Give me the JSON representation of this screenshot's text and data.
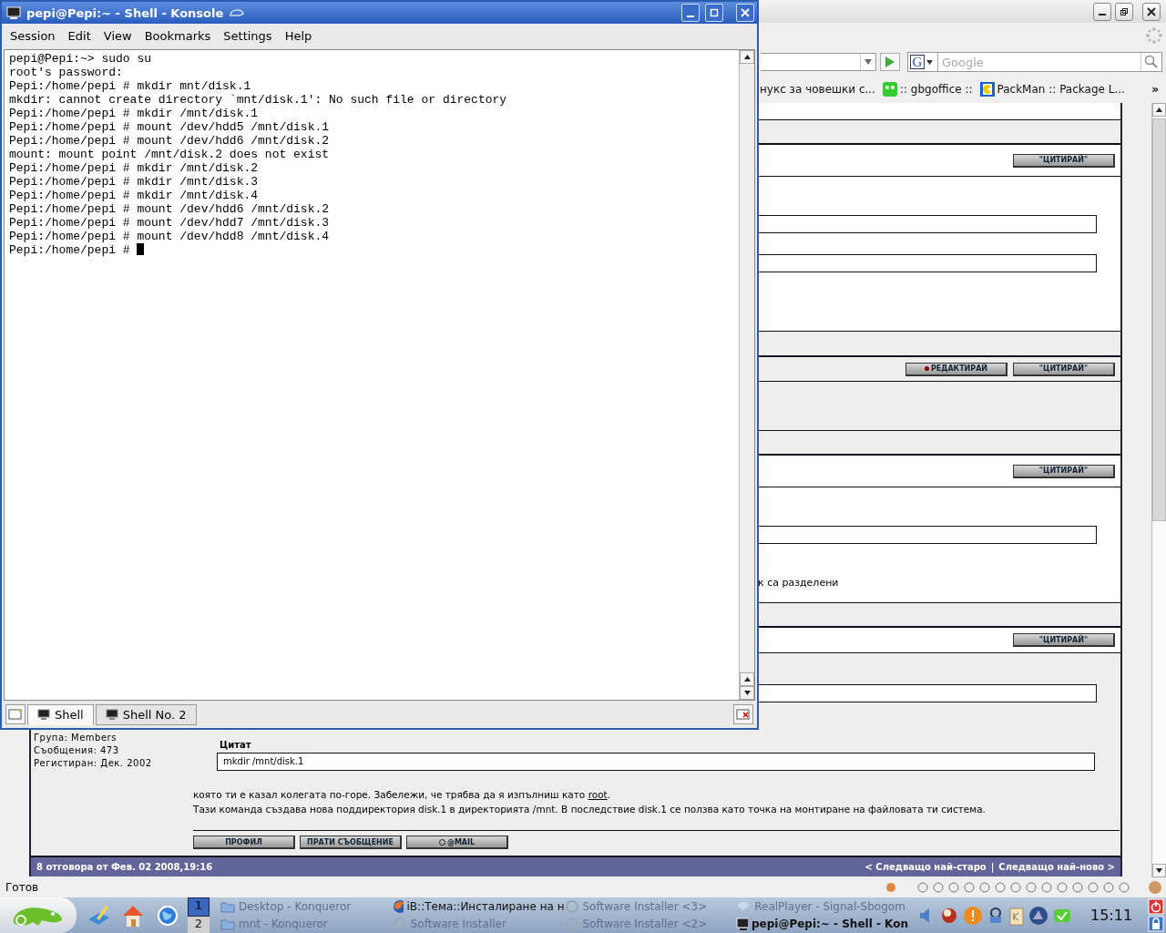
{
  "browser": {
    "search": {
      "placeholder": "Google",
      "engine": "G"
    },
    "bookmarks": [
      {
        "label": "нукс за човешки с..."
      },
      {
        "label": ":: gbgoffice ::"
      },
      {
        "label": "PackMan :: Package L..."
      }
    ],
    "more": "»",
    "posts": [
      {
        "buttons": [
          {
            "label": "\"ЦИТИРАЙ\"",
            "kind": "quote"
          }
        ]
      },
      {
        "buttons": [
          {
            "label": "РЕДАКТИРАЙ",
            "kind": "edit"
          },
          {
            "label": "\"ЦИТИРАЙ\"",
            "kind": "quote"
          }
        ]
      },
      {
        "buttons": [
          {
            "label": "\"ЦИТИРАЙ\"",
            "kind": "quote"
          }
        ],
        "line": "к са разделени"
      },
      {
        "buttons": [
          {
            "label": "\"ЦИТИРАЙ\"",
            "kind": "quote"
          }
        ]
      }
    ],
    "last_post": {
      "author_info": [
        "Група: Members",
        "Съобщения: 473",
        "Регистиран: Дек. 2002"
      ],
      "quote_label": "Цитат",
      "quote": "mkdir /mnt/disk.1",
      "paragraph_1": "която ти е казал колегата по-горе. Забележи, че трябва да я изпълниш като",
      "link": "root",
      "after_link": ".",
      "paragraph_2": "Тази команда създава нова поддиректория disk.1 в директорията /mnt. В последствие disk.1 се ползва като точка на монтиране на файловата ти система.",
      "buttons": [
        {
          "label": "ПРОФИЛ",
          "kind": "plain"
        },
        {
          "label": "ПРАТИ СЪОБЩЕНИЕ",
          "kind": "plain"
        },
        {
          "label": "@MAIL",
          "kind": "mail"
        }
      ]
    },
    "footer": {
      "left": "8 отговора от Фев. 02 2008,19:16",
      "links": [
        "< Следващо най-старо",
        "Следващо най-ново >"
      ],
      "separator": "|"
    },
    "status": "Готов"
  },
  "konsole": {
    "title": "pepi@Pepi:~ - Shell - Konsole",
    "menu": [
      "Session",
      "Edit",
      "View",
      "Bookmarks",
      "Settings",
      "Help"
    ],
    "lines": [
      "pepi@Pepi:~> sudo su",
      "root's password:",
      "Pepi:/home/pepi # mkdir mnt/disk.1",
      "mkdir: cannot create directory `mnt/disk.1': No such file or directory",
      "Pepi:/home/pepi # mkdir /mnt/disk.1",
      "Pepi:/home/pepi # mount /dev/hdd5 /mnt/disk.1",
      "Pepi:/home/pepi # mount /dev/hdd6 /mnt/disk.2",
      "mount: mount point /mnt/disk.2 does not exist",
      "Pepi:/home/pepi # mkdir /mnt/disk.2",
      "Pepi:/home/pepi # mkdir /mnt/disk.3",
      "Pepi:/home/pepi # mkdir /mnt/disk.4",
      "Pepi:/home/pepi # mount /dev/hdd6 /mnt/disk.2",
      "Pepi:/home/pepi # mount /dev/hdd7 /mnt/disk.3",
      "Pepi:/home/pepi # mount /dev/hdd8 /mnt/disk.4",
      "Pepi:/home/pepi # "
    ],
    "tabs": [
      {
        "label": "Shell",
        "selected": true
      },
      {
        "label": "Shell No. 2",
        "selected": false
      }
    ]
  },
  "taskbar": {
    "desktops": [
      {
        "label": "1",
        "selected": true
      },
      {
        "label": "2",
        "selected": false
      }
    ],
    "tasks": [
      {
        "label": "Desktop - Konqueror",
        "minimized": true,
        "active": false
      },
      {
        "label": "mnt - Konqueror",
        "minimized": true,
        "active": false
      },
      {
        "label": "iB::Тема::Инсталиране на н",
        "minimized": false,
        "active": false
      },
      {
        "label": "Software Installer",
        "minimized": true,
        "active": false
      },
      {
        "label": "Software Installer <3>",
        "minimized": true,
        "active": false
      },
      {
        "label": "Software Installer <2>",
        "minimized": true,
        "active": false
      },
      {
        "label": "RealPlayer - Signal-Sbogom",
        "minimized": true,
        "active": false
      },
      {
        "label": "pepi@Pepi:~ - Shell - Kon",
        "minimized": false,
        "active": true
      }
    ],
    "clock": "15:11"
  }
}
